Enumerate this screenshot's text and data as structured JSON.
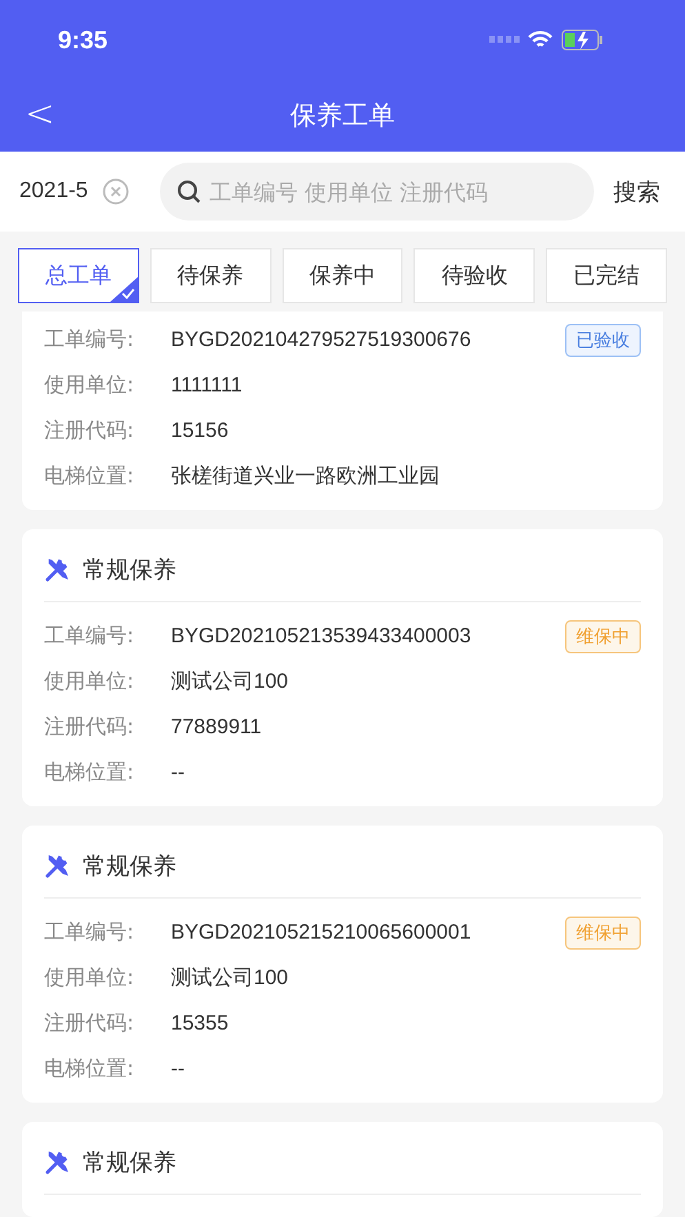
{
  "status_bar": {
    "time": "9:35"
  },
  "nav": {
    "back": "<",
    "title": "保养工单"
  },
  "filter": {
    "date": "2021-5",
    "search_placeholder": "工单编号 使用单位 注册代码",
    "search_button": "搜索"
  },
  "tabs": [
    {
      "label": "总工单",
      "selected": true
    },
    {
      "label": "待保养",
      "selected": false
    },
    {
      "label": "保养中",
      "selected": false
    },
    {
      "label": "待验收",
      "selected": false
    },
    {
      "label": "已完结",
      "selected": false
    }
  ],
  "orders": [
    {
      "fields": [
        {
          "label": "工单编号:",
          "value": "BYGD202104279527519300676"
        },
        {
          "label": "使用单位:",
          "value": "1111111"
        },
        {
          "label": "注册代码:",
          "value": "15156"
        },
        {
          "label": "电梯位置:",
          "value": "张槎街道兴业一路欧洲工业园"
        }
      ],
      "status": {
        "kind": "accepted",
        "label": "已验收"
      }
    },
    {
      "title": "常规保养",
      "fields": [
        {
          "label": "工单编号:",
          "value": "BYGD202105213539433400003"
        },
        {
          "label": "使用单位:",
          "value": "测试公司100"
        },
        {
          "label": "注册代码:",
          "value": "77889911"
        },
        {
          "label": "电梯位置:",
          "value": "--"
        }
      ],
      "status": {
        "kind": "in_progress",
        "label": "维保中"
      }
    },
    {
      "title": "常规保养",
      "fields": [
        {
          "label": "工单编号:",
          "value": "BYGD202105215210065600001"
        },
        {
          "label": "使用单位:",
          "value": "测试公司100"
        },
        {
          "label": "注册代码:",
          "value": "15355"
        },
        {
          "label": "电梯位置:",
          "value": "--"
        }
      ],
      "status": {
        "kind": "in_progress",
        "label": "维保中"
      }
    },
    {
      "title": "常规保养"
    }
  ]
}
